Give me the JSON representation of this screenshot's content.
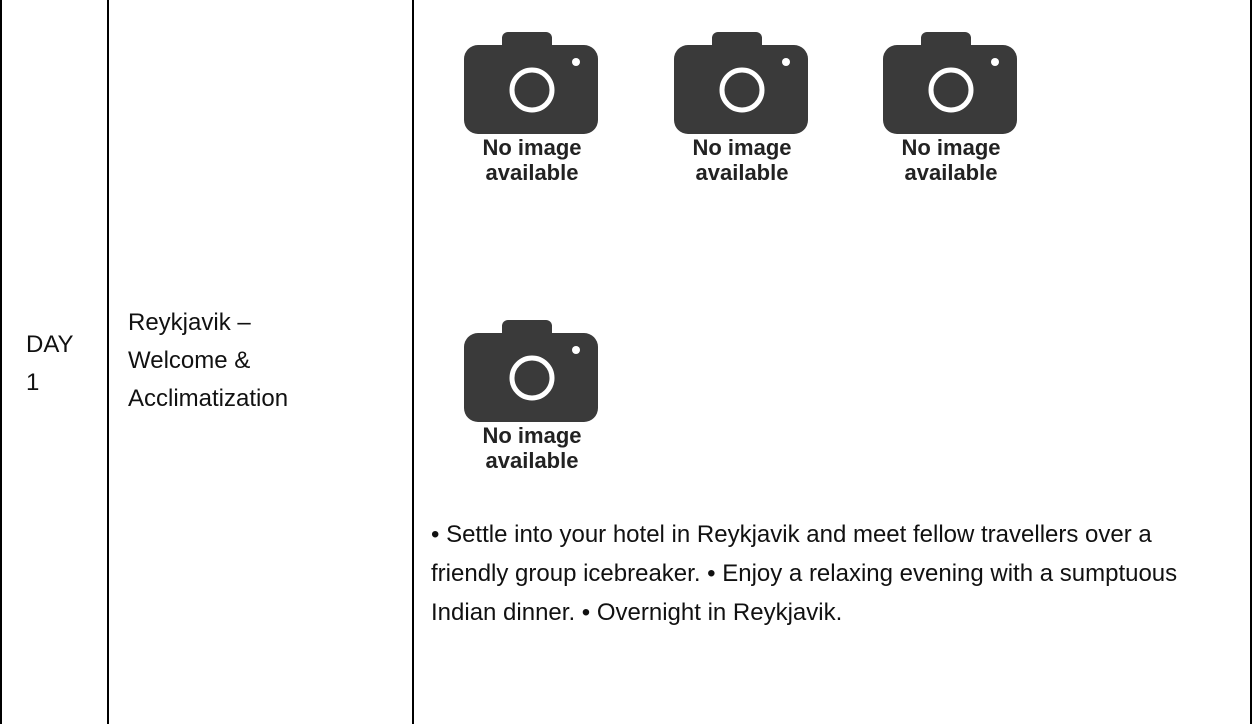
{
  "row": {
    "day_line1": "DAY",
    "day_line2": "1",
    "title_lines": [
      "Reykjavik –",
      "Welcome &",
      "Acclimatization"
    ]
  },
  "images": [
    {
      "icon": "camera-icon",
      "caption_line1": "No image",
      "caption_line2": "available"
    },
    {
      "icon": "camera-icon",
      "caption_line1": "No image",
      "caption_line2": "available"
    },
    {
      "icon": "camera-icon",
      "caption_line1": "No image",
      "caption_line2": "available"
    },
    {
      "icon": "camera-icon",
      "caption_line1": "No image",
      "caption_line2": "available"
    }
  ],
  "description": "• Settle into your hotel in Reykjavik and meet fellow travellers over a friendly group icebreaker. • Enjoy a relaxing evening with a sumptuous Indian dinner. • Overnight in Reykjavik.",
  "colors": {
    "icon_fill": "#3a3a3a",
    "border": "#000000",
    "text": "#111111"
  }
}
